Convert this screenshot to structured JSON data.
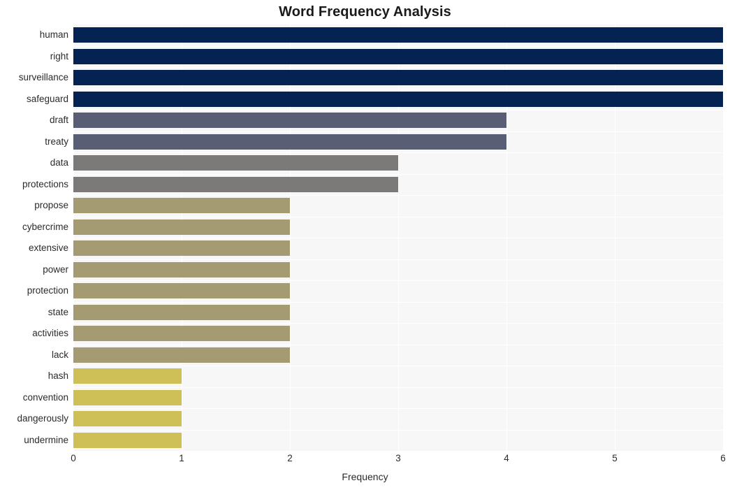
{
  "chart_data": {
    "type": "bar",
    "orientation": "horizontal",
    "title": "Word Frequency Analysis",
    "xlabel": "Frequency",
    "ylabel": "",
    "categories": [
      "human",
      "right",
      "surveillance",
      "safeguard",
      "draft",
      "treaty",
      "data",
      "protections",
      "propose",
      "cybercrime",
      "extensive",
      "power",
      "protection",
      "state",
      "activities",
      "lack",
      "hash",
      "convention",
      "dangerously",
      "undermine"
    ],
    "values": [
      6,
      6,
      6,
      6,
      4,
      4,
      3,
      3,
      2,
      2,
      2,
      2,
      2,
      2,
      2,
      2,
      1,
      1,
      1,
      1
    ],
    "bar_colors": [
      "#042252",
      "#042252",
      "#042252",
      "#042252",
      "#5a5e75",
      "#5a5e75",
      "#7b7a78",
      "#7b7a78",
      "#a49b73",
      "#a49b73",
      "#a49b73",
      "#a49b73",
      "#a49b73",
      "#a49b73",
      "#a49b73",
      "#a49b73",
      "#cec057",
      "#cec057",
      "#cec057",
      "#cec057"
    ],
    "xlim": [
      0,
      6
    ],
    "xticks": [
      0,
      1,
      2,
      3,
      4,
      5,
      6
    ],
    "xtick_labels": [
      "0",
      "1",
      "2",
      "3",
      "4",
      "5",
      "6"
    ],
    "grid": true,
    "grid_color": "#ffffff",
    "plot_background": "#f7f7f7",
    "figure_background": "#ffffff",
    "legend": null
  }
}
